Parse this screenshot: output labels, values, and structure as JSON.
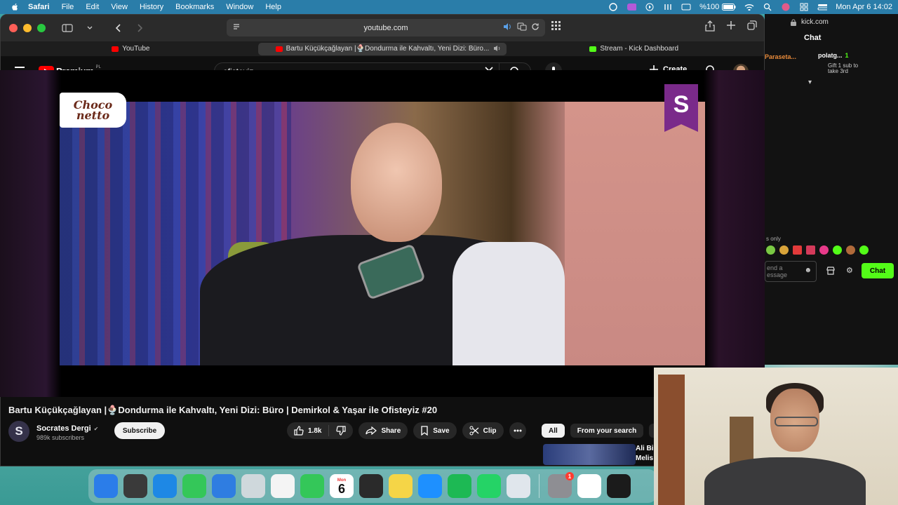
{
  "menubar": {
    "app": "Safari",
    "items": [
      "File",
      "Edit",
      "View",
      "History",
      "Bookmarks",
      "Window",
      "Help"
    ],
    "battery": "%100",
    "clock": "Mon Apr 6  14:02"
  },
  "safari": {
    "url": "youtube.com",
    "tabs": [
      {
        "label": "YouTube",
        "favicon_color": "#ff0000"
      },
      {
        "label": "Bartu Küçükçağlayan |🍨Dondurma ile Kahvaltı, Yeni Dizi: Büro...",
        "favicon_color": "#ff0000"
      },
      {
        "label": "Stream - Kick Dashboard",
        "favicon_color": "#53fc18"
      }
    ]
  },
  "youtube": {
    "logo": "Premium",
    "logo_region": "PL",
    "search_query": "ofisteyiz",
    "create_label": "Create",
    "video": {
      "sponsor_line1": "Choco",
      "sponsor_line2": "netto",
      "channel_badge": "S",
      "title": "Bartu Küçükçağlayan |🍨Dondurma ile Kahvaltı, Yeni Dizi: Büro | Demirkol & Yaşar ile Ofisteyiz #20",
      "channel_name": "Socrates Dergi",
      "channel_logo": "S",
      "subscribers": "989k subscribers",
      "subscribe_label": "Subscribe",
      "likes": "1.8k",
      "share_label": "Share",
      "save_label": "Save",
      "clip_label": "Clip"
    },
    "chips": [
      "All",
      "From your search",
      "Fr"
    ],
    "recommended_title_line1": "Ali Bi",
    "recommended_title_line2": "Melis"
  },
  "kick": {
    "url": "kick.com",
    "title": "Chat",
    "pinned_user_left": "Paraseta...",
    "pinned_user": "polatg...",
    "pinned_count": "1",
    "gift_line1": "Gift 1 sub to",
    "gift_line2": "take 3rd",
    "emotes_label": "s only",
    "input_line1": "end a",
    "input_line2": "essage",
    "chat_button": "Chat"
  },
  "dock": {
    "apps": [
      {
        "name": "finder-icon",
        "color": "#2b7de9"
      },
      {
        "name": "launchpad-icon",
        "color": "#3a3a3a"
      },
      {
        "name": "safari-icon",
        "color": "#1e88e5"
      },
      {
        "name": "messages-icon",
        "color": "#34c759"
      },
      {
        "name": "mail-icon",
        "color": "#2f7de1"
      },
      {
        "name": "appstore-alt-icon",
        "color": "#cfd8dc"
      },
      {
        "name": "photos-icon",
        "color": "#f4f4f4"
      },
      {
        "name": "facetime-icon",
        "color": "#34c759"
      },
      {
        "name": "calendar-icon",
        "color": "#ffffff"
      },
      {
        "name": "reminders-icon",
        "color": "#2a2a2a"
      },
      {
        "name": "notes-icon",
        "color": "#f5d547"
      },
      {
        "name": "appstore-icon",
        "color": "#1e90ff"
      },
      {
        "name": "spotify-icon",
        "color": "#1db954"
      },
      {
        "name": "whatsapp-icon",
        "color": "#25d366"
      },
      {
        "name": "files-icon",
        "color": "#e0e6ec"
      },
      {
        "name": "system-settings-icon",
        "color": "#8e8e93"
      },
      {
        "name": "chrome-icon",
        "color": "#ffffff"
      },
      {
        "name": "obs-icon",
        "color": "#1b1b1b"
      }
    ],
    "calendar_month": "Mon",
    "calendar_day": "6",
    "settings_badge": "1"
  }
}
